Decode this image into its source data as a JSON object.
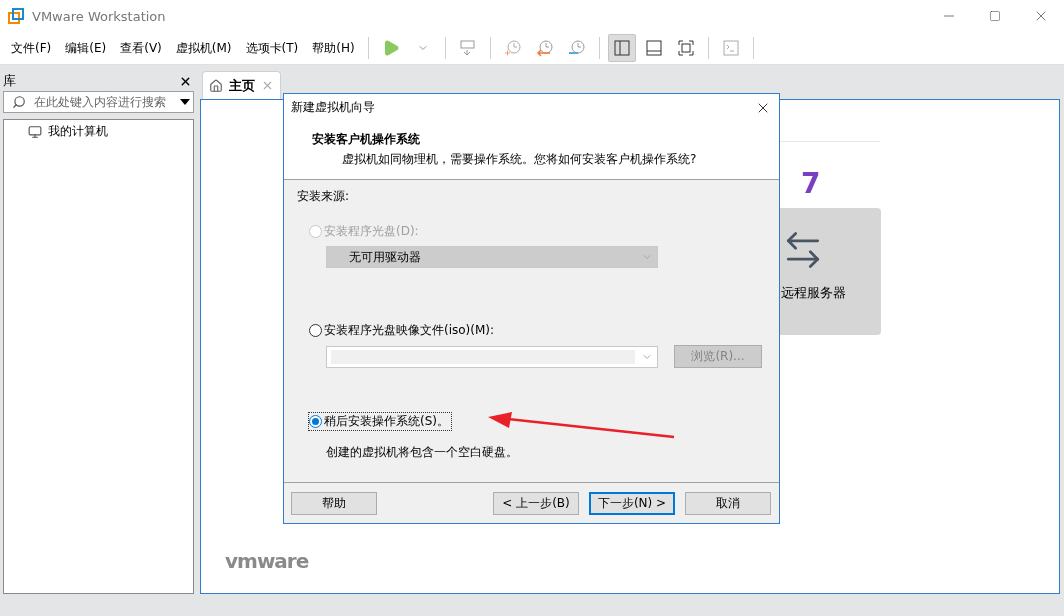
{
  "window": {
    "title": "VMware Workstation"
  },
  "menu": [
    "文件(F)",
    "编辑(E)",
    "查看(V)",
    "虚拟机(M)",
    "选项卡(T)",
    "帮助(H)"
  ],
  "toolbar": [
    {
      "kind": "play"
    },
    {
      "kind": "caret"
    },
    {
      "kind": "separator"
    },
    {
      "kind": "send_keys"
    },
    {
      "kind": "separator"
    },
    {
      "kind": "snapshot"
    },
    {
      "kind": "revert"
    },
    {
      "kind": "manage"
    },
    {
      "kind": "separator"
    },
    {
      "kind": "sidebar",
      "selected": true
    },
    {
      "kind": "console",
      "selected": false
    },
    {
      "kind": "fullscreen",
      "selected": false
    },
    {
      "kind": "separator"
    },
    {
      "kind": "terminal"
    },
    {
      "kind": "separator"
    }
  ],
  "library": {
    "title": "库",
    "search": {
      "placeholder": "在此处键入内容进行搜索"
    },
    "tree": [
      {
        "label": "我的计算机"
      }
    ]
  },
  "tabs": [
    {
      "label": "主页",
      "selected": true
    }
  ],
  "home": {
    "version_fragment": "7",
    "cards": [
      {
        "label": "远程服务器"
      }
    ],
    "logo": "vmware"
  },
  "dialog": {
    "title": "新建虚拟机向导",
    "heading": "安装客户机操作系统",
    "subheading": "虚拟机如同物理机，需要操作系统。您将如何安装客户机操作系统?",
    "source_label": "安装来源:",
    "options": [
      {
        "label": "安装程序光盘(D):",
        "selected": false,
        "disabled": true,
        "field": {
          "value": "无可用驱动器",
          "disabled": true
        }
      },
      {
        "label": "安装程序光盘映像文件(iso)(M):",
        "selected": false,
        "disabled": false,
        "field": {
          "disabled": true
        },
        "browse": {
          "label": "浏览(R)...",
          "disabled": true
        }
      },
      {
        "label": "稍后安装操作系统(S)。",
        "selected": true,
        "disabled": false,
        "note": "创建的虚拟机将包含一个空白硬盘。"
      }
    ],
    "buttons": [
      {
        "label": "帮助",
        "default": false
      },
      {
        "label": "< 上一步(B)",
        "default": false
      },
      {
        "label": "下一步(N) >",
        "default": true
      },
      {
        "label": "取消",
        "default": false
      }
    ]
  }
}
